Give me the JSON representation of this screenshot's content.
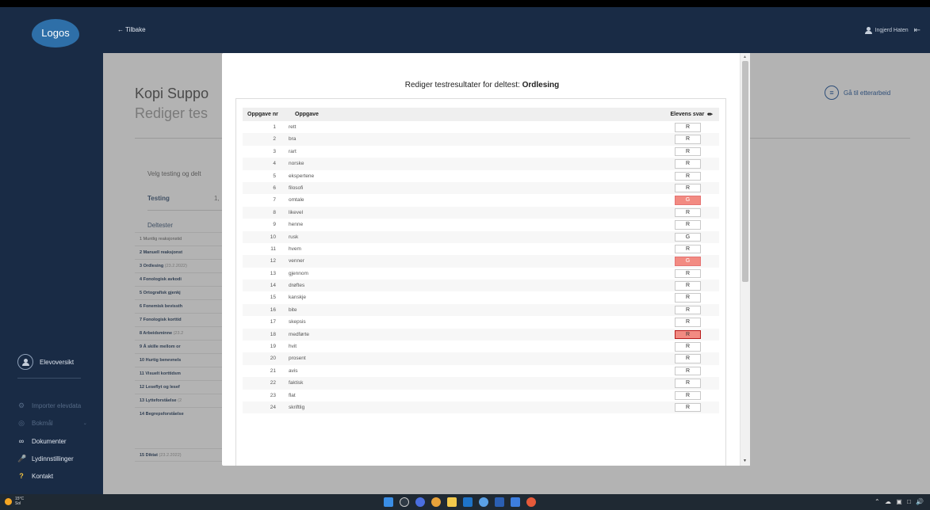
{
  "app": {
    "logo": "Logos",
    "back_label": "← Tilbake",
    "user_name": "Ingjerd Haten"
  },
  "sidebar": {
    "elevoversikt": "Elevoversikt",
    "items": [
      {
        "label": "Importer elevdata",
        "icon": "gear-icon"
      },
      {
        "label": "Bokmål",
        "icon": "globe-icon"
      },
      {
        "label": "Dokumenter",
        "icon": "link-icon"
      },
      {
        "label": "Lydinnstillinger",
        "icon": "microphone-icon"
      },
      {
        "label": "Kontakt",
        "icon": "question-icon"
      }
    ]
  },
  "background": {
    "title_line1": "Kopi Suppo",
    "title_line2": "Rediger tes",
    "velg_label": "Velg testing og delt",
    "testing_label": "Testing",
    "testing_value": "1,",
    "deltester_label": "Deltester",
    "go_etterarbeid": "Gå til etterarbeid",
    "deltester": [
      {
        "name": "1 Muntlig reaksjonstid",
        "date": ""
      },
      {
        "name": "2 Manuell reaksjonst",
        "date": ""
      },
      {
        "name": "3 Ordlesing",
        "date": "(23.2.2022)"
      },
      {
        "name": "4 Fonologisk avkodi",
        "date": ""
      },
      {
        "name": "5 Ortografisk gjenkj",
        "date": ""
      },
      {
        "name": "6 Fonemisk bevissth",
        "date": ""
      },
      {
        "name": "7 Fonologisk korttid",
        "date": ""
      },
      {
        "name": "8 Arbeidsminne",
        "date": "(23.2"
      },
      {
        "name": "9 Å skille mellom or",
        "date": ""
      },
      {
        "name": "10 Hurtig benevnels",
        "date": ""
      },
      {
        "name": "11 Visuelt korttidsm",
        "date": ""
      },
      {
        "name": "12 Leseflyt og lesef",
        "date": ""
      },
      {
        "name": "13 Lytteforståelse",
        "date": "(2"
      },
      {
        "name": "14 Begrepsforståelse",
        "date": ""
      }
    ],
    "last_row": {
      "name": "15 Diktat",
      "date": "(23.2.2022)"
    }
  },
  "modal": {
    "title_prefix": "Rediger testresultater for deltest: ",
    "title_test": "Ordlesing",
    "col_nr": "Oppgave nr",
    "col_oppgave": "Oppgave",
    "col_svar": "Elevens svar",
    "rows": [
      {
        "nr": "1",
        "word": "rett",
        "svar": "R",
        "red": false
      },
      {
        "nr": "2",
        "word": "bra",
        "svar": "R",
        "red": false
      },
      {
        "nr": "3",
        "word": "rart",
        "svar": "R",
        "red": false
      },
      {
        "nr": "4",
        "word": "norske",
        "svar": "R",
        "red": false
      },
      {
        "nr": "5",
        "word": "ekspertene",
        "svar": "R",
        "red": false
      },
      {
        "nr": "6",
        "word": "filosofi",
        "svar": "R",
        "red": false
      },
      {
        "nr": "7",
        "word": "omtale",
        "svar": "G",
        "red": true
      },
      {
        "nr": "8",
        "word": "likevel",
        "svar": "R",
        "red": false
      },
      {
        "nr": "9",
        "word": "henne",
        "svar": "R",
        "red": false
      },
      {
        "nr": "10",
        "word": "rusk",
        "svar": "G",
        "red": false
      },
      {
        "nr": "11",
        "word": "hvem",
        "svar": "R",
        "red": false
      },
      {
        "nr": "12",
        "word": "venner",
        "svar": "G",
        "red": true
      },
      {
        "nr": "13",
        "word": "gjennom",
        "svar": "R",
        "red": false
      },
      {
        "nr": "14",
        "word": "drøftes",
        "svar": "R",
        "red": false
      },
      {
        "nr": "15",
        "word": "kanskje",
        "svar": "R",
        "red": false
      },
      {
        "nr": "16",
        "word": "bite",
        "svar": "R",
        "red": false
      },
      {
        "nr": "17",
        "word": "skepsis",
        "svar": "R",
        "red": false
      },
      {
        "nr": "18",
        "word": "medførte",
        "svar": "R",
        "red": true,
        "focus": true
      },
      {
        "nr": "19",
        "word": "hvit",
        "svar": "R",
        "red": false
      },
      {
        "nr": "20",
        "word": "prosent",
        "svar": "R",
        "red": false
      },
      {
        "nr": "21",
        "word": "avis",
        "svar": "R",
        "red": false
      },
      {
        "nr": "22",
        "word": "faktisk",
        "svar": "R",
        "red": false
      },
      {
        "nr": "23",
        "word": "flat",
        "svar": "R",
        "red": false
      },
      {
        "nr": "24",
        "word": "skriftlig",
        "svar": "R",
        "red": false
      }
    ]
  },
  "taskbar": {
    "temp": "15°C",
    "weather": "Sol"
  },
  "colors": {
    "navy": "#192b45",
    "wrong_answer": "#f28b82"
  }
}
